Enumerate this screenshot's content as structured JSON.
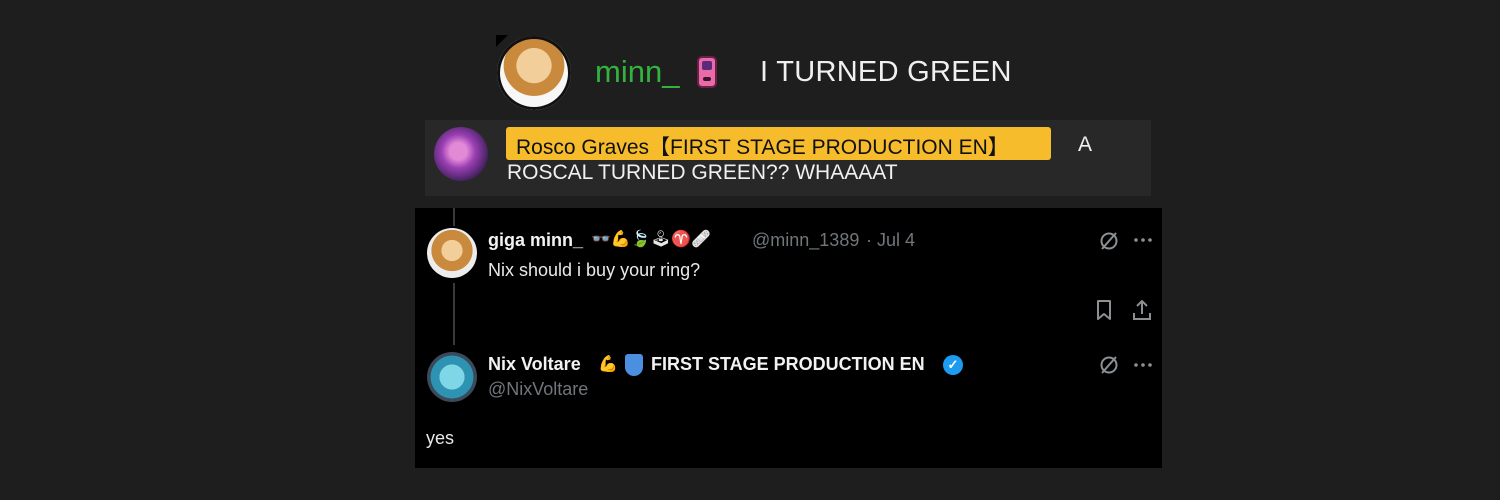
{
  "chat": [
    {
      "username": "minn_",
      "badge": "gameboy-icon",
      "message": "I TURNED GREEN",
      "name_color": "#33b23e"
    },
    {
      "username": "Rosco Graves【FIRST STAGE PRODUCTION EN】",
      "message_part1": "A",
      "message_part2": "ROSCAL TURNED GREEN?? WHAAAAT",
      "highlight_color": "#f6bc2b"
    }
  ],
  "tweets": [
    {
      "display_name": "giga minn_",
      "emojis": "👓💪🍃🕹♈🩹",
      "handle": "@minn_1389",
      "separator": "·",
      "date": "Jul 4",
      "text": "Nix should i buy your ring?"
    },
    {
      "display_name": "Nix Voltare",
      "emojis": "💪",
      "org": "FIRST STAGE PRODUCTION EN",
      "handle": "@NixVoltare",
      "text": "yes",
      "verified_color": "#1d9bf0"
    }
  ],
  "icons": {
    "grok": "grok-icon",
    "more": "more-icon",
    "bookmark": "bookmark-icon",
    "share": "share-icon",
    "verified": "verified-icon"
  }
}
